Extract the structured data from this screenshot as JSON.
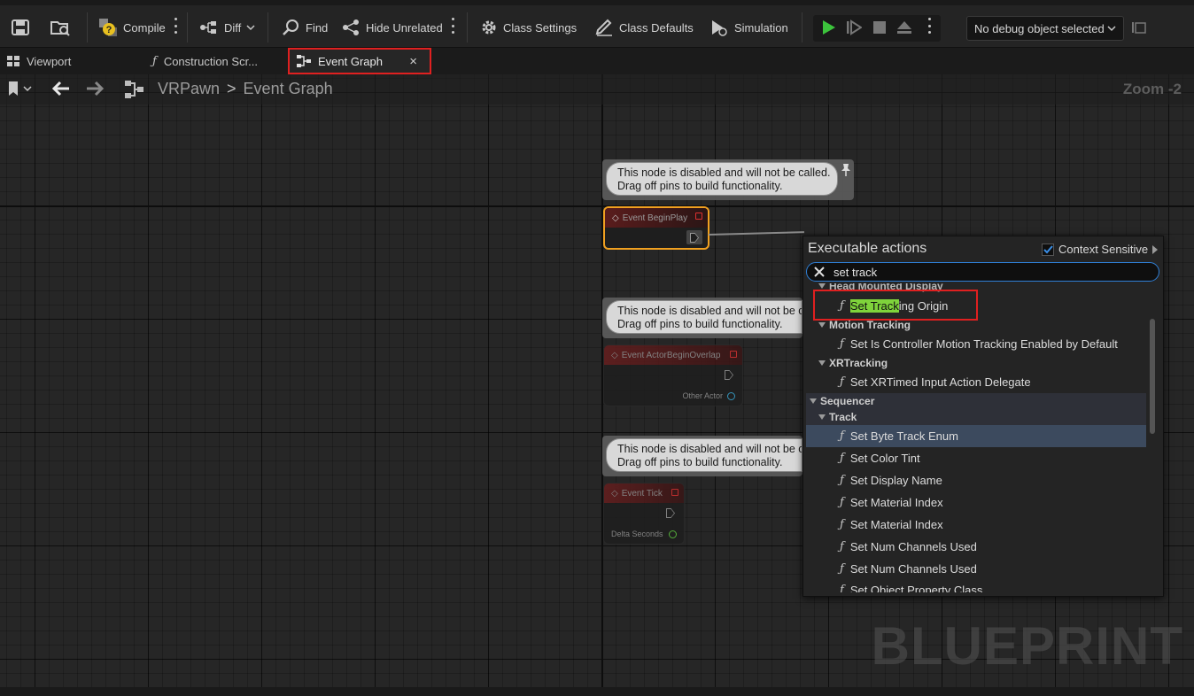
{
  "toolbar": {
    "compile": "Compile",
    "diff": "Diff",
    "find": "Find",
    "hide_unrelated": "Hide Unrelated",
    "class_settings": "Class Settings",
    "class_defaults": "Class Defaults",
    "simulation": "Simulation",
    "debug_object": "No debug object selected"
  },
  "tabs": {
    "viewport": "Viewport",
    "construction": "Construction Scr...",
    "event_graph": "Event Graph",
    "close": "×"
  },
  "breadcrumb": {
    "root": "VRPawn",
    "sep": ">",
    "current": "Event Graph"
  },
  "zoom": "Zoom -2",
  "watermark": "BLUEPRINT",
  "comment_text": {
    "line1": "This node is disabled and will not be called.",
    "line2": "Drag off pins to build functionality."
  },
  "nodes": {
    "begin_play": "Event BeginPlay",
    "actor_overlap": "Event ActorBeginOverlap",
    "other_actor": "Other Actor",
    "tick": "Event Tick",
    "delta_seconds": "Delta Seconds"
  },
  "popup": {
    "title": "Executable actions",
    "context_sensitive": "Context Sensitive",
    "context_checked": true,
    "search_value": "set track",
    "categories": {
      "head_mounted": "Head Mounted Display",
      "motion_tracking": "Motion Tracking",
      "xr_tracking": "XRTracking",
      "sequencer": "Sequencer",
      "track": "Track"
    },
    "items": {
      "set_tracking_origin_match": "Set Track",
      "set_tracking_origin_rest": "ing Origin",
      "motion": "Set Is Controller Motion Tracking Enabled by Default",
      "xr": "Set XRTimed Input Action Delegate",
      "byte": "Set Byte Track Enum",
      "color": "Set Color Tint",
      "display": "Set Display Name",
      "mat1": "Set Material Index",
      "mat2": "Set Material Index",
      "num1": "Set Num Channels Used",
      "num2": "Set Num Channels Used",
      "objprop": "Set Object Property Class"
    }
  },
  "colors": {
    "highlight_box": "#e02020",
    "search_border": "#2f7fd6",
    "match_highlight": "#7fd33b",
    "play_green": "#3cc43c",
    "selected_node": "#f0a020"
  }
}
